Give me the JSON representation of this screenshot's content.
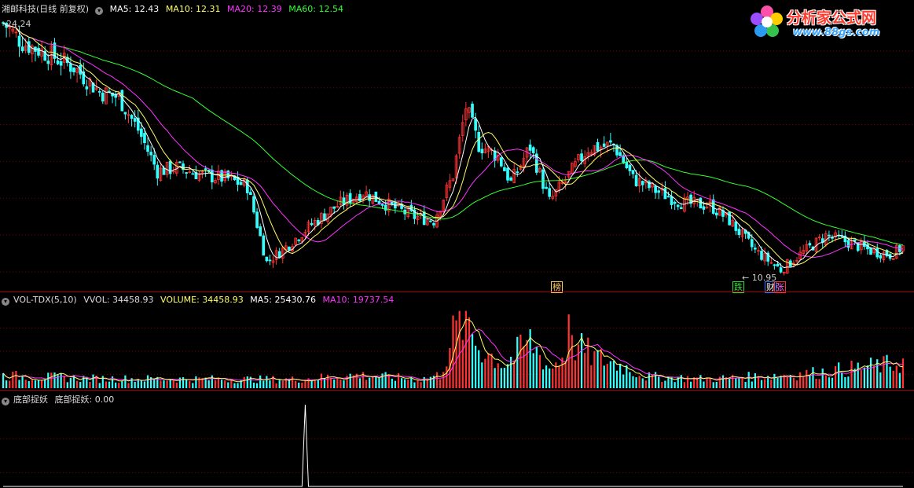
{
  "header": {
    "stock_name": "湘邮科技(日线 前复权)",
    "ma5": "MA5: 12.43",
    "ma10": "MA10: 12.31",
    "ma20": "MA20: 12.39",
    "ma60": "MA60: 12.54"
  },
  "price_pane": {
    "high_label": "24.24",
    "low_label": "10.95",
    "markers": [
      {
        "text": "榜",
        "color": "#ffcc66"
      },
      {
        "text": "跌",
        "color": "#33dd33"
      },
      {
        "text": "财",
        "color": "#ffffff"
      },
      {
        "text": "张",
        "color": "#ff66ff"
      }
    ]
  },
  "volume_pane": {
    "indicator": "VOL-TDX(5,10)",
    "vvol": "VVOL: 34458.93",
    "volume": "VOLUME: 34458.93",
    "ma5": "MA5: 25430.76",
    "ma10": "MA10: 19737.54"
  },
  "bottom_pane": {
    "indicator": "底部捉妖",
    "value": "底部捉妖: 0.00"
  },
  "logo": {
    "title": "分析家公式网",
    "url": "www.88gs.com"
  },
  "colors": {
    "up": "#ff3333",
    "down": "#33ffff",
    "ma5": "#ffffff",
    "ma10": "#ffff66",
    "ma20": "#ff33ff",
    "ma60": "#33ff33",
    "grid": "#7a0000",
    "indicator": "#ffffff"
  },
  "chart_data": {
    "type": "candlestick",
    "price_anchors": [
      [
        0,
        24.24
      ],
      [
        6,
        23.2
      ],
      [
        14,
        22.6
      ],
      [
        22,
        21.9
      ],
      [
        30,
        20.6
      ],
      [
        36,
        20.3
      ],
      [
        42,
        18.6
      ],
      [
        48,
        16.4
      ],
      [
        54,
        16.6
      ],
      [
        62,
        16.2
      ],
      [
        70,
        16.0
      ],
      [
        76,
        15.6
      ],
      [
        82,
        11.6
      ],
      [
        88,
        12.4
      ],
      [
        96,
        13.6
      ],
      [
        104,
        14.6
      ],
      [
        112,
        15.3
      ],
      [
        120,
        14.6
      ],
      [
        128,
        14.0
      ],
      [
        134,
        13.8
      ],
      [
        140,
        16.2
      ],
      [
        144,
        19.8
      ],
      [
        148,
        17.8
      ],
      [
        154,
        17.2
      ],
      [
        158,
        15.8
      ],
      [
        164,
        17.7
      ],
      [
        170,
        14.8
      ],
      [
        176,
        16.2
      ],
      [
        182,
        17.6
      ],
      [
        190,
        17.8
      ],
      [
        196,
        16.0
      ],
      [
        204,
        15.3
      ],
      [
        212,
        14.7
      ],
      [
        220,
        14.6
      ],
      [
        226,
        13.8
      ],
      [
        234,
        12.2
      ],
      [
        242,
        11.2
      ],
      [
        248,
        12.0
      ],
      [
        256,
        13.0
      ],
      [
        262,
        12.7
      ],
      [
        270,
        12.2
      ],
      [
        276,
        12.0
      ],
      [
        280,
        12.4
      ]
    ],
    "volume_anchors": [
      [
        0,
        5200
      ],
      [
        30,
        3900
      ],
      [
        60,
        3800
      ],
      [
        90,
        3600
      ],
      [
        110,
        5400
      ],
      [
        130,
        3700
      ],
      [
        136,
        5500
      ],
      [
        140,
        22000
      ],
      [
        144,
        29000
      ],
      [
        148,
        17000
      ],
      [
        156,
        9800
      ],
      [
        164,
        19600
      ],
      [
        170,
        8000
      ],
      [
        178,
        17600
      ],
      [
        184,
        13000
      ],
      [
        192,
        9600
      ],
      [
        200,
        4800
      ],
      [
        220,
        3800
      ],
      [
        250,
        6000
      ],
      [
        280,
        10400
      ]
    ],
    "bottom_signals": [
      {
        "index": 94,
        "value": 1
      }
    ],
    "ranges": {
      "price": [
        10.5,
        24.7
      ],
      "volume": [
        0,
        34458.93
      ],
      "indicator": [
        0,
        1
      ]
    },
    "count": 281
  }
}
